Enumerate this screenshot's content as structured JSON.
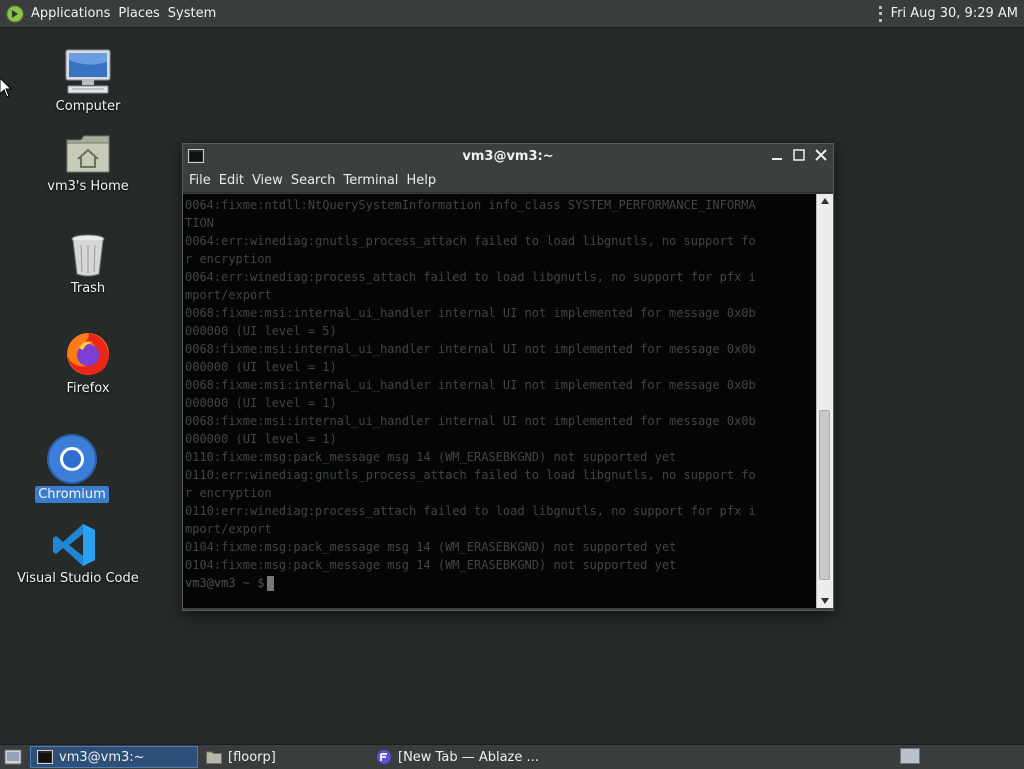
{
  "top_panel": {
    "menus": [
      "Applications",
      "Places",
      "System"
    ],
    "clock": "Fri Aug 30,  9:29 AM"
  },
  "desktop": {
    "icons": [
      {
        "label": "Computer",
        "icon": "computer-icon"
      },
      {
        "label": "vm3's Home",
        "icon": "home-folder-icon"
      },
      {
        "label": "Trash",
        "icon": "trash-icon"
      },
      {
        "label": "Firefox",
        "icon": "firefox-icon"
      },
      {
        "label": "Chromium",
        "icon": "chromium-icon",
        "selected": true
      },
      {
        "label": "Visual Studio Code",
        "icon": "vscode-icon"
      }
    ]
  },
  "terminal": {
    "title": "vm3@vm3:~",
    "menu": [
      "File",
      "Edit",
      "View",
      "Search",
      "Terminal",
      "Help"
    ],
    "lines": [
      "0064:fixme:ntdll:NtQuerySystemInformation info_class SYSTEM_PERFORMANCE_INFORMA",
      "TION",
      "0064:err:winediag:gnutls_process_attach failed to load libgnutls, no support fo",
      "r encryption",
      "0064:err:winediag:process_attach failed to load libgnutls, no support for pfx i",
      "mport/export",
      "0068:fixme:msi:internal_ui_handler internal UI not implemented for message 0x0b",
      "000000 (UI level = 5)",
      "0068:fixme:msi:internal_ui_handler internal UI not implemented for message 0x0b",
      "000000 (UI level = 1)",
      "0068:fixme:msi:internal_ui_handler internal UI not implemented for message 0x0b",
      "000000 (UI level = 1)",
      "0068:fixme:msi:internal_ui_handler internal UI not implemented for message 0x0b",
      "000000 (UI level = 1)",
      "0110:fixme:msg:pack_message msg 14 (WM_ERASEBKGND) not supported yet",
      "0110:err:winediag:gnutls_process_attach failed to load libgnutls, no support fo",
      "r encryption",
      "0110:err:winediag:process_attach failed to load libgnutls, no support for pfx i",
      "mport/export",
      "0104:fixme:msg:pack_message msg 14 (WM_ERASEBKGND) not supported yet",
      "0104:fixme:msg:pack_message msg 14 (WM_ERASEBKGND) not supported yet"
    ],
    "prompt": "vm3@vm3 ~ $"
  },
  "taskbar": {
    "tasks": [
      {
        "label": "vm3@vm3:~",
        "icon": "terminal-icon",
        "active": true
      },
      {
        "label": "[floorp]",
        "icon": "folder-icon",
        "active": false
      },
      {
        "label": "[New Tab — Ablaze ...",
        "icon": "floorp-icon",
        "active": false
      }
    ]
  }
}
